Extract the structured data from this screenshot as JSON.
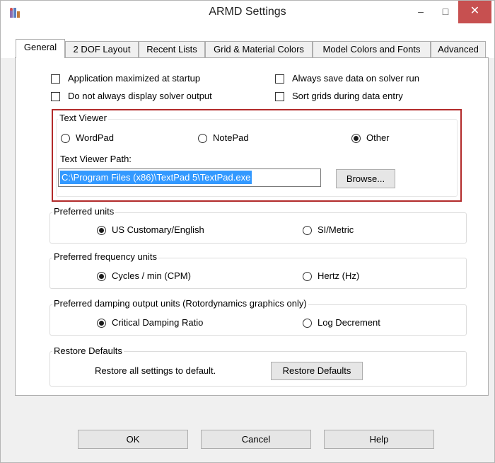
{
  "window": {
    "title": "ARMD Settings",
    "minimize_glyph": "–",
    "maximize_glyph": "□",
    "close_glyph": "✕",
    "accent_close": "#c75050"
  },
  "tabs": [
    {
      "label": "General",
      "active": true
    },
    {
      "label": "2 DOF Layout"
    },
    {
      "label": "Recent Lists"
    },
    {
      "label": "Grid & Material Colors"
    },
    {
      "label": "Model Colors and Fonts"
    },
    {
      "label": "Advanced"
    }
  ],
  "options": {
    "app_maximized": {
      "label": "Application maximized at startup",
      "checked": false
    },
    "no_solver_output": {
      "label": "Do not always display solver output",
      "checked": false
    },
    "always_save": {
      "label": "Always save data on solver run",
      "checked": false
    },
    "sort_grids": {
      "label": "Sort grids during data entry",
      "checked": false
    }
  },
  "text_viewer": {
    "title": "Text Viewer",
    "options": [
      "WordPad",
      "NotePad",
      "Other"
    ],
    "selected": "Other",
    "path_label": "Text Viewer Path:",
    "path_value": "C:\\Program Files (x86)\\TextPad 5\\TextPad.exe",
    "browse_label": "Browse...",
    "highlight_color": "#b22a2a"
  },
  "preferred_units": {
    "title": "Preferred units",
    "options": [
      "US Customary/English",
      "SI/Metric"
    ],
    "selected": "US Customary/English"
  },
  "frequency_units": {
    "title": "Preferred frequency units",
    "options": [
      "Cycles / min (CPM)",
      "Hertz (Hz)"
    ],
    "selected": "Cycles / min (CPM)"
  },
  "damping_units": {
    "title": "Preferred damping output units (Rotordynamics graphics only)",
    "options": [
      "Critical Damping Ratio",
      "Log Decrement"
    ],
    "selected": "Critical Damping Ratio"
  },
  "restore": {
    "title": "Restore Defaults",
    "description": "Restore all settings to default.",
    "button_label": "Restore Defaults"
  },
  "footer": {
    "ok_label": "OK",
    "cancel_label": "Cancel",
    "help_label": "Help"
  }
}
